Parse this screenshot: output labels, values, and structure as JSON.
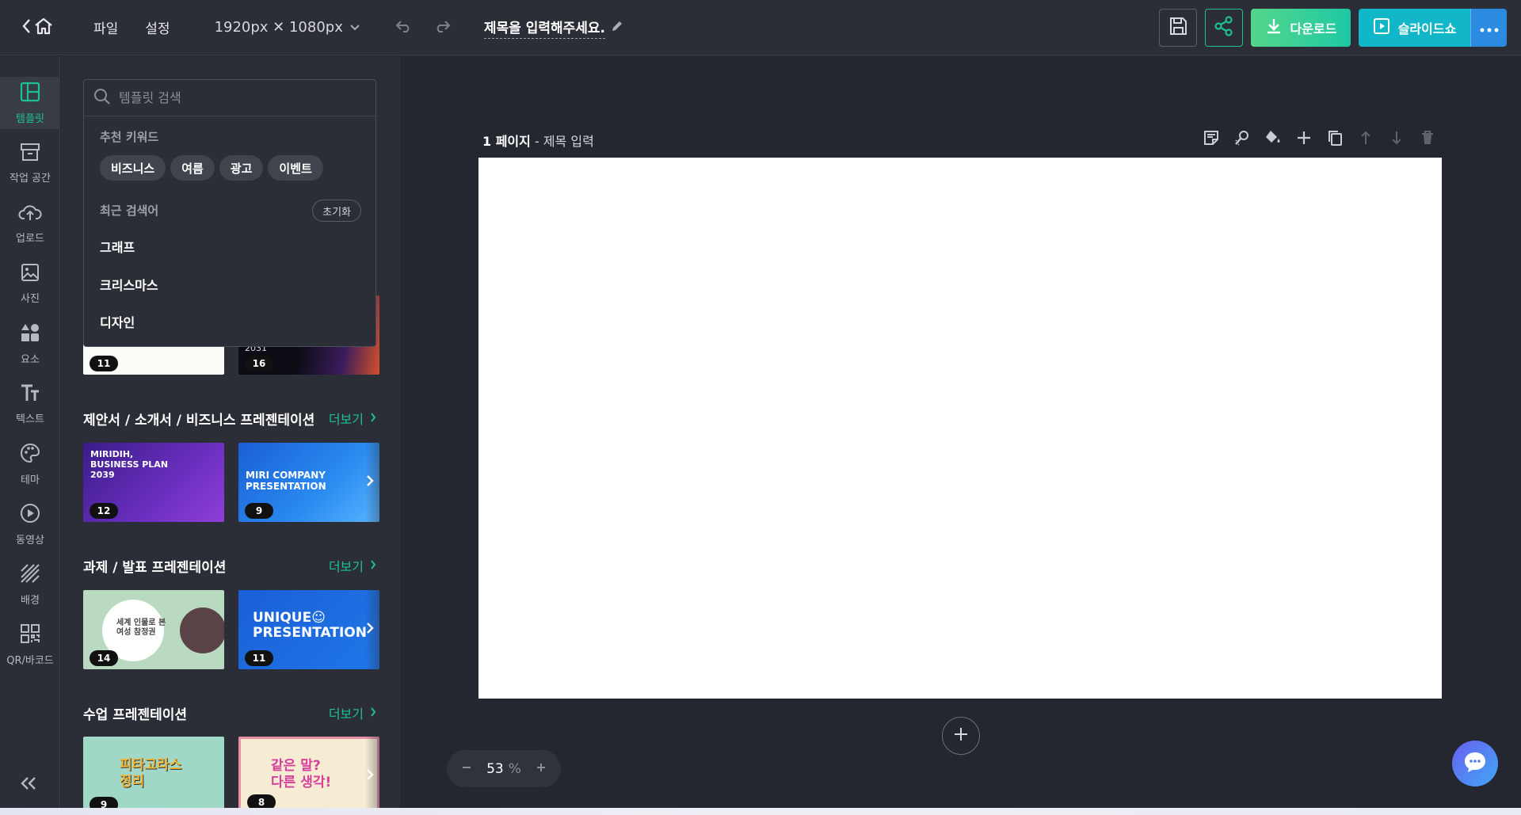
{
  "topbar": {
    "menu_file": "파일",
    "menu_settings": "설정",
    "size": "1920px ✕ 1080px",
    "title": "제목을 입력해주세요.",
    "download": "다운로드",
    "slideshow": "슬라이드쇼"
  },
  "nav": {
    "template": "템플릿",
    "workspace": "작업 공간",
    "upload": "업로드",
    "photo": "사진",
    "element": "요소",
    "text": "텍스트",
    "theme": "테마",
    "video": "동영상",
    "background": "배경",
    "qr": "QR/바코드"
  },
  "search": {
    "placeholder": "템플릿 검색",
    "recommend_title": "추천 키워드",
    "chips": [
      "비즈니스",
      "여름",
      "광고",
      "이벤트"
    ],
    "recent_title": "최근 검색어",
    "reset": "초기화",
    "recent": [
      "그래프",
      "크리스마스",
      "디자인"
    ]
  },
  "panel": {
    "hidden_row_counts": [
      "11",
      "16"
    ],
    "hidden_row_text": "2031",
    "more": "더보기",
    "sections": [
      {
        "title": "제안서 / 소개서 / 비즈니스 프레젠테이션",
        "thumbs": [
          {
            "text": "MIRIDIH,\nBUSINESS PLAN\n2039",
            "count": "12"
          },
          {
            "text": "MIRI COMPANY\nPRESENTATION",
            "count": "9"
          }
        ]
      },
      {
        "title": "과제 / 발표 프레젠테이션",
        "thumbs": [
          {
            "text": "세계 인물로 본\n여성 참정권",
            "count": "14"
          },
          {
            "text": "UNIQUE☺\nPRESENTATION",
            "count": "11"
          }
        ]
      },
      {
        "title": "수업 프레젠테이션",
        "thumbs": [
          {
            "text": "피타고라스\n정리",
            "count": "9"
          },
          {
            "text": "같은 말?\n다른 생각!",
            "count": "8"
          }
        ]
      }
    ]
  },
  "canvas": {
    "page_no": "1 페이지",
    "page_title": "- 제목 입력"
  },
  "zoom": {
    "value": "53",
    "unit": "%"
  },
  "colors": {
    "accent_green": "#1ec08e",
    "download_gradient": [
      "#54d68a",
      "#1ec8a5"
    ],
    "slideshow": "#12b6c9",
    "more_blue": "#2a8be0"
  }
}
